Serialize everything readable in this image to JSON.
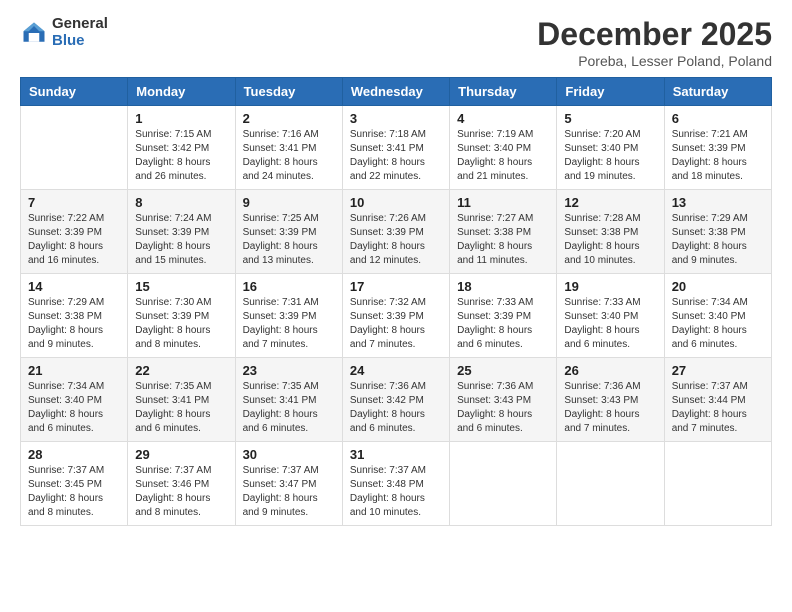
{
  "header": {
    "logo_general": "General",
    "logo_blue": "Blue",
    "month_title": "December 2025",
    "location": "Poreba, Lesser Poland, Poland"
  },
  "days_of_week": [
    "Sunday",
    "Monday",
    "Tuesday",
    "Wednesday",
    "Thursday",
    "Friday",
    "Saturday"
  ],
  "weeks": [
    [
      {
        "day": "",
        "info": ""
      },
      {
        "day": "1",
        "info": "Sunrise: 7:15 AM\nSunset: 3:42 PM\nDaylight: 8 hours\nand 26 minutes."
      },
      {
        "day": "2",
        "info": "Sunrise: 7:16 AM\nSunset: 3:41 PM\nDaylight: 8 hours\nand 24 minutes."
      },
      {
        "day": "3",
        "info": "Sunrise: 7:18 AM\nSunset: 3:41 PM\nDaylight: 8 hours\nand 22 minutes."
      },
      {
        "day": "4",
        "info": "Sunrise: 7:19 AM\nSunset: 3:40 PM\nDaylight: 8 hours\nand 21 minutes."
      },
      {
        "day": "5",
        "info": "Sunrise: 7:20 AM\nSunset: 3:40 PM\nDaylight: 8 hours\nand 19 minutes."
      },
      {
        "day": "6",
        "info": "Sunrise: 7:21 AM\nSunset: 3:39 PM\nDaylight: 8 hours\nand 18 minutes."
      }
    ],
    [
      {
        "day": "7",
        "info": "Sunrise: 7:22 AM\nSunset: 3:39 PM\nDaylight: 8 hours\nand 16 minutes."
      },
      {
        "day": "8",
        "info": "Sunrise: 7:24 AM\nSunset: 3:39 PM\nDaylight: 8 hours\nand 15 minutes."
      },
      {
        "day": "9",
        "info": "Sunrise: 7:25 AM\nSunset: 3:39 PM\nDaylight: 8 hours\nand 13 minutes."
      },
      {
        "day": "10",
        "info": "Sunrise: 7:26 AM\nSunset: 3:39 PM\nDaylight: 8 hours\nand 12 minutes."
      },
      {
        "day": "11",
        "info": "Sunrise: 7:27 AM\nSunset: 3:38 PM\nDaylight: 8 hours\nand 11 minutes."
      },
      {
        "day": "12",
        "info": "Sunrise: 7:28 AM\nSunset: 3:38 PM\nDaylight: 8 hours\nand 10 minutes."
      },
      {
        "day": "13",
        "info": "Sunrise: 7:29 AM\nSunset: 3:38 PM\nDaylight: 8 hours\nand 9 minutes."
      }
    ],
    [
      {
        "day": "14",
        "info": "Sunrise: 7:29 AM\nSunset: 3:38 PM\nDaylight: 8 hours\nand 9 minutes."
      },
      {
        "day": "15",
        "info": "Sunrise: 7:30 AM\nSunset: 3:39 PM\nDaylight: 8 hours\nand 8 minutes."
      },
      {
        "day": "16",
        "info": "Sunrise: 7:31 AM\nSunset: 3:39 PM\nDaylight: 8 hours\nand 7 minutes."
      },
      {
        "day": "17",
        "info": "Sunrise: 7:32 AM\nSunset: 3:39 PM\nDaylight: 8 hours\nand 7 minutes."
      },
      {
        "day": "18",
        "info": "Sunrise: 7:33 AM\nSunset: 3:39 PM\nDaylight: 8 hours\nand 6 minutes."
      },
      {
        "day": "19",
        "info": "Sunrise: 7:33 AM\nSunset: 3:40 PM\nDaylight: 8 hours\nand 6 minutes."
      },
      {
        "day": "20",
        "info": "Sunrise: 7:34 AM\nSunset: 3:40 PM\nDaylight: 8 hours\nand 6 minutes."
      }
    ],
    [
      {
        "day": "21",
        "info": "Sunrise: 7:34 AM\nSunset: 3:40 PM\nDaylight: 8 hours\nand 6 minutes."
      },
      {
        "day": "22",
        "info": "Sunrise: 7:35 AM\nSunset: 3:41 PM\nDaylight: 8 hours\nand 6 minutes."
      },
      {
        "day": "23",
        "info": "Sunrise: 7:35 AM\nSunset: 3:41 PM\nDaylight: 8 hours\nand 6 minutes."
      },
      {
        "day": "24",
        "info": "Sunrise: 7:36 AM\nSunset: 3:42 PM\nDaylight: 8 hours\nand 6 minutes."
      },
      {
        "day": "25",
        "info": "Sunrise: 7:36 AM\nSunset: 3:43 PM\nDaylight: 8 hours\nand 6 minutes."
      },
      {
        "day": "26",
        "info": "Sunrise: 7:36 AM\nSunset: 3:43 PM\nDaylight: 8 hours\nand 7 minutes."
      },
      {
        "day": "27",
        "info": "Sunrise: 7:37 AM\nSunset: 3:44 PM\nDaylight: 8 hours\nand 7 minutes."
      }
    ],
    [
      {
        "day": "28",
        "info": "Sunrise: 7:37 AM\nSunset: 3:45 PM\nDaylight: 8 hours\nand 8 minutes."
      },
      {
        "day": "29",
        "info": "Sunrise: 7:37 AM\nSunset: 3:46 PM\nDaylight: 8 hours\nand 8 minutes."
      },
      {
        "day": "30",
        "info": "Sunrise: 7:37 AM\nSunset: 3:47 PM\nDaylight: 8 hours\nand 9 minutes."
      },
      {
        "day": "31",
        "info": "Sunrise: 7:37 AM\nSunset: 3:48 PM\nDaylight: 8 hours\nand 10 minutes."
      },
      {
        "day": "",
        "info": ""
      },
      {
        "day": "",
        "info": ""
      },
      {
        "day": "",
        "info": ""
      }
    ]
  ]
}
